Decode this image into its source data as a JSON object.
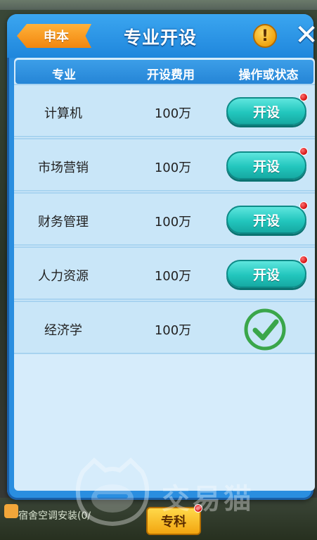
{
  "dialog": {
    "title": "专业开设",
    "back_label": "申本",
    "info_icon": "exclamation-icon",
    "close_icon": "close-icon"
  },
  "table": {
    "headers": [
      "专业",
      "开设费用",
      "操作或状态"
    ],
    "rows": [
      {
        "name": "计算机",
        "cost": "100万",
        "action": "开设",
        "status": "open-button",
        "notify": true
      },
      {
        "name": "市场营销",
        "cost": "100万",
        "action": "开设",
        "status": "open-button",
        "notify": true
      },
      {
        "name": "财务管理",
        "cost": "100万",
        "action": "开设",
        "status": "open-button",
        "notify": true
      },
      {
        "name": "人力资源",
        "cost": "100万",
        "action": "开设",
        "status": "open-button",
        "notify": true
      },
      {
        "name": "经济学",
        "cost": "100万",
        "action": "",
        "status": "opened-check",
        "notify": false
      }
    ]
  },
  "bottom": {
    "left_label": "宿舍空调安装(0/",
    "tab_button": "专科"
  },
  "watermark": {
    "text": "交易猫"
  },
  "colors": {
    "panel": "#2a8ee0",
    "content": "#d6ecfb",
    "row": "#c9e6f8",
    "open_button": "#22c6bd",
    "check": "#3aa64a",
    "back_tab": "#f2860e"
  }
}
